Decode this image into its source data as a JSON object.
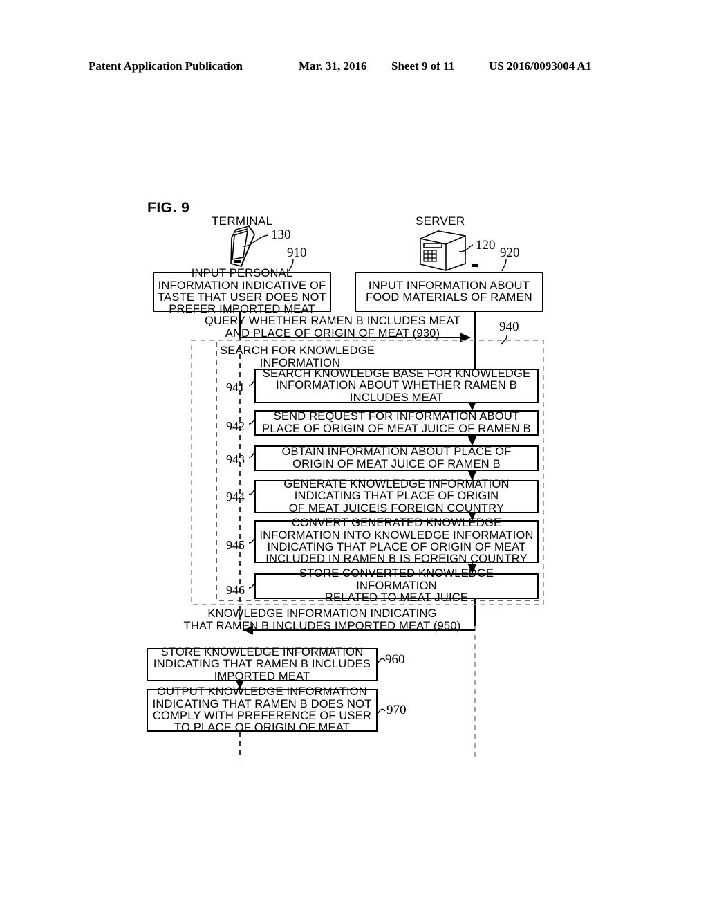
{
  "header": {
    "publication": "Patent Application Publication",
    "date": "Mar. 31, 2016",
    "sheet": "Sheet 9 of 11",
    "patent_number": "US 2016/0093004 A1"
  },
  "figure": {
    "label": "FIG. 9"
  },
  "actors": [
    {
      "name": "TERMINAL",
      "ref": "130",
      "icon": "smartphone-icon"
    },
    {
      "name": "SERVER",
      "ref": "120",
      "icon": "server-icon"
    }
  ],
  "boxes": {
    "b910": {
      "ref": "910",
      "lines": [
        "INPUT PERSONAL",
        "INFORMATION INDICATIVE OF",
        "TASTE THAT USER DOES NOT",
        "PREFER IMPORTED MEAT"
      ]
    },
    "b920": {
      "ref": "920",
      "lines": [
        "INPUT INFORMATION ABOUT",
        "FOOD MATERIALS OF RAMEN"
      ]
    },
    "b941": {
      "ref": "941",
      "lines": [
        "SEARCH KNOWLEDGE BASE FOR KNOWLEDGE",
        "INFORMATION ABOUT WHETHER RAMEN B",
        "INCLUDES MEAT"
      ]
    },
    "b942": {
      "ref": "942",
      "lines": [
        "SEND REQUEST FOR INFORMATION ABOUT",
        "PLACE OF ORIGIN OF MEAT JUICE OF RAMEN B"
      ]
    },
    "b943": {
      "ref": "943",
      "lines": [
        "OBTAIN INFORMATION ABOUT PLACE OF",
        "ORIGIN OF MEAT JUICE OF RAMEN B"
      ]
    },
    "b944": {
      "ref": "944",
      "lines": [
        "GENERATE KNOWLEDGE INFORMATION",
        "INDICATING THAT PLACE OF ORIGIN",
        "OF MEAT JUICEIS FOREIGN COUNTRY"
      ]
    },
    "b945": {
      "ref": "945",
      "lines": [
        "CONVERT GENERATED KNOWLEDGE",
        "INFORMATION INTO KNOWLEDGE INFORMATION",
        "INDICATING THAT PLACE OF ORIGIN OF MEAT",
        "INCLUDED IN RAMEN B IS FOREIGN COUNTRY"
      ]
    },
    "b946": {
      "ref": "946",
      "lines": [
        "STORE CONVERTED KNOWLEDGE INFORMATION",
        "RELATED TO MEAT JUICE"
      ]
    },
    "b960": {
      "ref": "960",
      "lines": [
        "STORE KNOWLEDGE INFORMATION",
        "INDICATING THAT RAMEN B INCLUDES",
        "IMPORTED MEAT"
      ]
    },
    "b970": {
      "ref": "970",
      "lines": [
        "OUTPUT KNOWLEDGE INFORMATION",
        "INDICATING THAT RAMEN B DOES NOT",
        "COMPLY WITH PREFERENCE OF USER",
        "TO PLACE OF ORIGIN OF MEAT"
      ]
    }
  },
  "messages": {
    "m930": {
      "ref": "930",
      "lines": [
        "QUERY WHETHER RAMEN B INCLUDES MEAT",
        "AND PLACE OF ORIGIN OF MEAT (930)"
      ]
    },
    "m950": {
      "ref": "950",
      "lines": [
        "KNOWLEDGE INFORMATION INDICATING",
        "THAT RAMEN B INCLUDES IMPORTED MEAT (950)"
      ]
    }
  },
  "group": {
    "ref": "940",
    "line1": "SEARCH FOR KNOWLEDGE",
    "line2": "INFORMATION"
  },
  "colors": {
    "ink": "#000000",
    "paper": "#ffffff",
    "dashed_outer": "#9a9a9a"
  }
}
